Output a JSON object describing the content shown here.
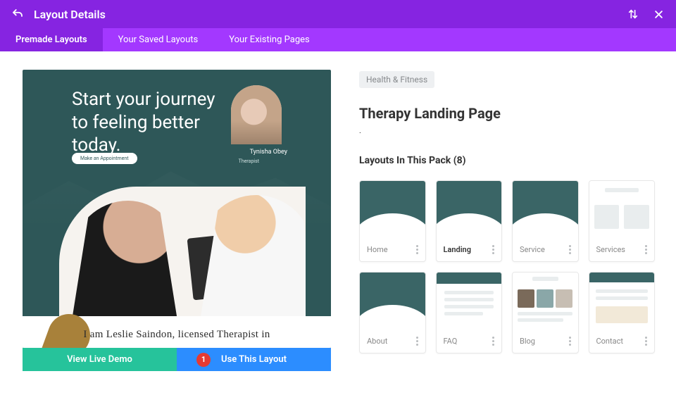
{
  "header": {
    "title": "Layout Details"
  },
  "tabs": [
    "Premade Layouts",
    "Your Saved Layouts",
    "Your Existing Pages"
  ],
  "preview": {
    "heroLine1": "Start your journey",
    "heroLine2": "to feeling better",
    "heroLine3": "today.",
    "pill": "Make an Appointment",
    "avatarName": "Tynisha Obey",
    "avatarRole": "Therapist",
    "subHeadline": "I am Leslie Saindon, licensed Therapist in"
  },
  "actions": {
    "demo": "View Live Demo",
    "use": "Use This Layout",
    "badge": "1"
  },
  "detail": {
    "tag": "Health & Fitness",
    "title": "Therapy Landing Page",
    "packHeader": "Layouts In This Pack (8)",
    "layouts": [
      "Home",
      "Landing",
      "Service",
      "Services",
      "About",
      "FAQ",
      "Blog",
      "Contact"
    ]
  }
}
